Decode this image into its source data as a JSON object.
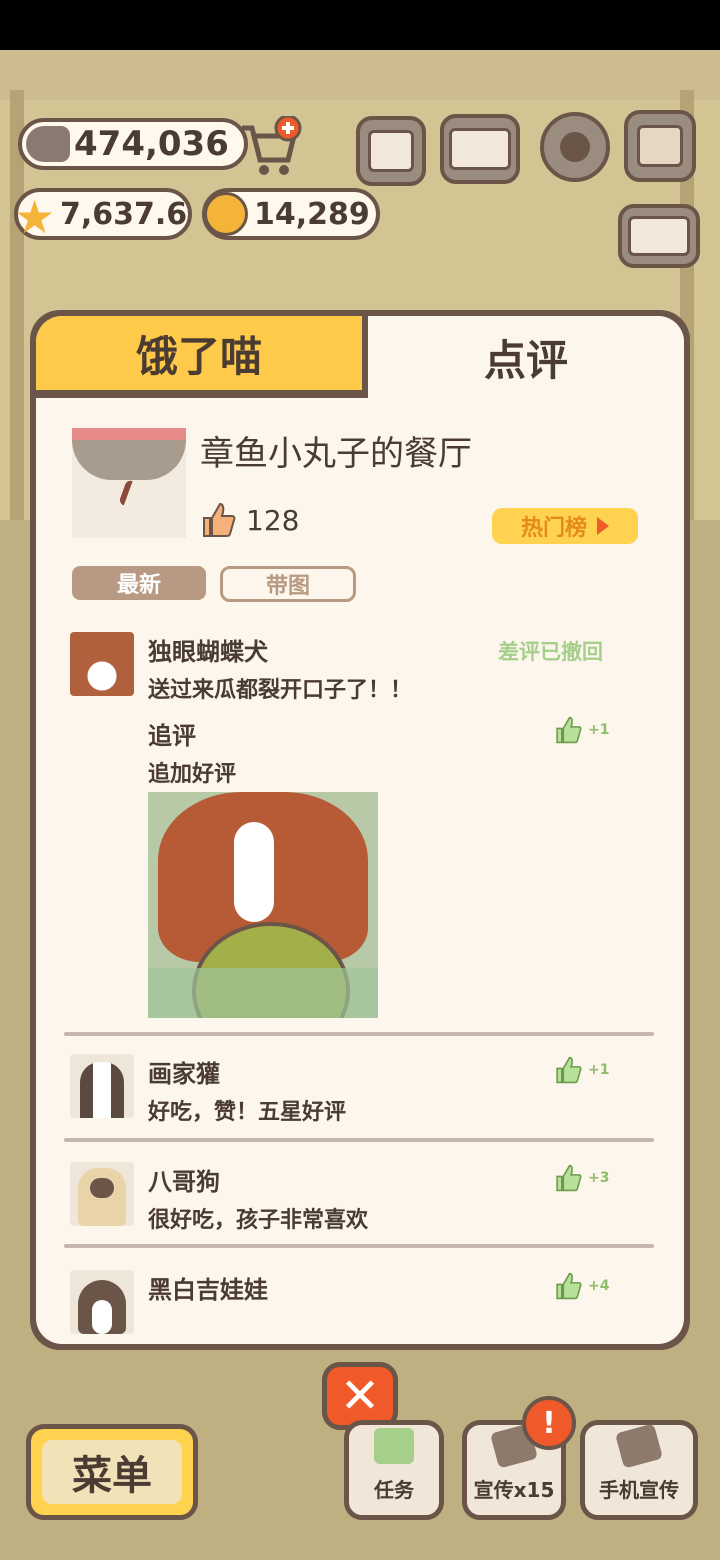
{
  "hud": {
    "fish": "474,036",
    "stars": "7,637.6",
    "bells": "14,289"
  },
  "panel": {
    "tab_left": "饿了喵",
    "tab_right": "点评",
    "shop_name": "章鱼小丸子的餐厅",
    "likes": "128",
    "hot_label": "热门榜",
    "filter_latest": "最新",
    "filter_image": "带图"
  },
  "reviews": [
    {
      "name": "独眼蝴蝶犬",
      "text": "送过来瓜都裂开口子了！！",
      "status": "差评已撤回",
      "followup_title": "追评",
      "followup_text": "追加好评",
      "followup_likes": "+1"
    },
    {
      "name": "画家獾",
      "text": "好吃，赞！五星好评",
      "likes": "+1"
    },
    {
      "name": "八哥狗",
      "text": "很好吃，孩子非常喜欢",
      "likes": "+3"
    },
    {
      "name": "黑白吉娃娃",
      "text": "",
      "likes": "+4"
    }
  ],
  "bottom": {
    "menu_label": "菜单",
    "task_label": "任务",
    "promo_label": "宣传x15",
    "phone_promo_label": "手机宣传",
    "close_symbol": "✕",
    "alert_symbol": "!"
  },
  "colors": {
    "accent_yellow": "#ffc94a",
    "outline": "#6b5548",
    "cream": "#fdf6ec",
    "like_green": "#8dbf6a",
    "close_red": "#f05a2a"
  }
}
